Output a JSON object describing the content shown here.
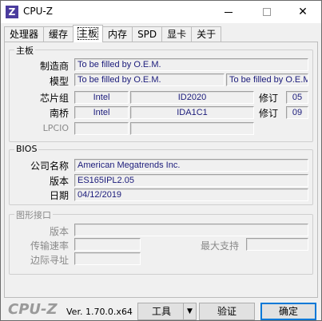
{
  "window": {
    "title": "CPU-Z",
    "icon_letter": "Z"
  },
  "tabs": [
    {
      "label": "处理器"
    },
    {
      "label": "缓存"
    },
    {
      "label": "主板"
    },
    {
      "label": "内存"
    },
    {
      "label": "SPD"
    },
    {
      "label": "显卡"
    },
    {
      "label": "关于"
    }
  ],
  "motherboard": {
    "group_title": "主板",
    "manufacturer_label": "制造商",
    "manufacturer": "To be filled by O.E.M.",
    "model_label": "模型",
    "model": "To be filled by O.E.M.",
    "model_rev": "To be filled by O.E.M.",
    "chipset_label": "芯片组",
    "chipset_vendor": "Intel",
    "chipset_model": "ID2020",
    "rev_label": "修订",
    "chipset_rev": "05",
    "southbridge_label": "南桥",
    "southbridge_vendor": "Intel",
    "southbridge_model": "IDA1C1",
    "southbridge_rev_label": "修订",
    "southbridge_rev": "09",
    "lpcio_label": "LPCIO"
  },
  "bios": {
    "group_title": "BIOS",
    "brand_label": "公司名称",
    "brand": "American Megatrends Inc.",
    "version_label": "版本",
    "version": "ES165IPL2.05",
    "date_label": "日期",
    "date": "04/12/2019"
  },
  "graphic_interface": {
    "group_title": "图形接口",
    "version_label": "版本",
    "transfer_rate_label": "传输速率",
    "max_supported_label": "最大支持",
    "side_band_label": "边际寻址"
  },
  "footer": {
    "logo": "CPU-Z",
    "version": "Ver. 1.70.0.x64",
    "tools_label": "工具",
    "validate_label": "验证",
    "ok_label": "确定"
  }
}
